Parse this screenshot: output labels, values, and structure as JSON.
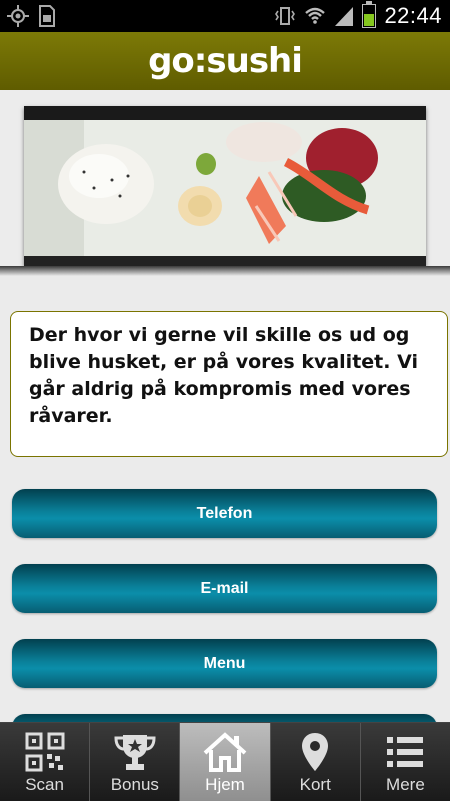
{
  "status_bar": {
    "time": "22:44",
    "icons": [
      "gps-icon",
      "sim-icon",
      "vibrate-icon",
      "wifi-icon",
      "signal-icon",
      "battery-icon"
    ]
  },
  "header": {
    "logo_text": "go:sushi",
    "background_color": "#6f6c03"
  },
  "hero": {
    "image_content": "sushi-sashimi-plate"
  },
  "info": {
    "text": "Der hvor vi gerne vil skille os ud og blive husket, er på vores kvalitet. Vi går aldrig på kompromis med vores råvarer."
  },
  "buttons": [
    {
      "label": "Telefon"
    },
    {
      "label": "E-mail"
    },
    {
      "label": "Menu"
    },
    {
      "label": ""
    }
  ],
  "button_color": "#0b7f98",
  "tabs": [
    {
      "label": "Scan",
      "icon": "qr-code-icon",
      "active": false
    },
    {
      "label": "Bonus",
      "icon": "trophy-icon",
      "active": false
    },
    {
      "label": "Hjem",
      "icon": "home-icon",
      "active": true
    },
    {
      "label": "Kort",
      "icon": "map-pin-icon",
      "active": false
    },
    {
      "label": "Mere",
      "icon": "list-icon",
      "active": false
    }
  ]
}
